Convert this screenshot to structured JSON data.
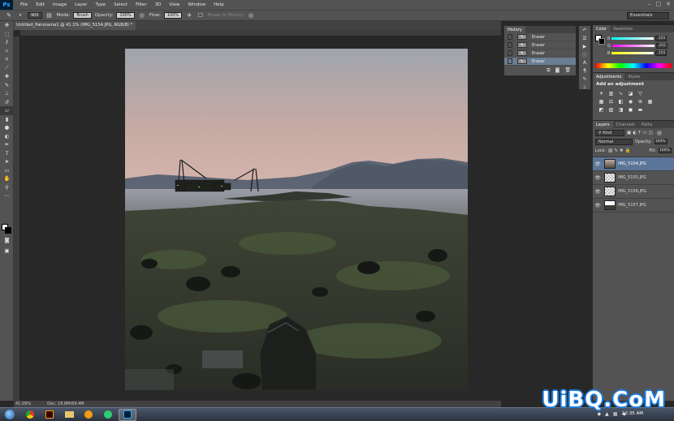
{
  "app": {
    "logo": "Ps"
  },
  "menu": [
    "File",
    "Edit",
    "Image",
    "Layer",
    "Type",
    "Select",
    "Filter",
    "3D",
    "View",
    "Window",
    "Help"
  ],
  "window_controls": [
    "–",
    "□",
    "✕"
  ],
  "options_bar": {
    "brush_size": "900",
    "mode_label": "Mode:",
    "mode_value": "Brush",
    "opacity_label": "Opacity:",
    "opacity_value": "100%",
    "flow_label": "Flow:",
    "flow_value": "100%",
    "erase_history": "Erase to History",
    "workspace": "Essentials"
  },
  "document": {
    "tab_title": "Untitled_Panorama1 @ 41.1% (IMG_5154.JPG, RGB/8) *",
    "zoom": "41.09%",
    "doc_info": "Doc: 16.8M/69.4M"
  },
  "history": {
    "tab": "History",
    "items": [
      {
        "label": "Eraser",
        "selected": false
      },
      {
        "label": "Eraser",
        "selected": false
      },
      {
        "label": "Eraser",
        "selected": false
      },
      {
        "label": "Eraser",
        "selected": true
      }
    ]
  },
  "color_panel": {
    "tabs": [
      "Color",
      "Swatches"
    ],
    "channels": [
      {
        "label": "R",
        "value": "255"
      },
      {
        "label": "G",
        "value": "255"
      },
      {
        "label": "B",
        "value": "255"
      }
    ]
  },
  "adjustments_panel": {
    "tabs": [
      "Adjustments",
      "Styles"
    ],
    "heading": "Add an adjustment"
  },
  "layers_panel": {
    "tabs": [
      "Layers",
      "Channels",
      "Paths"
    ],
    "kind": "Kind",
    "blend_mode": "Normal",
    "opacity_label": "Opacity:",
    "opacity_value": "100%",
    "lock_label": "Lock:",
    "fill_label": "Fill:",
    "fill_value": "100%",
    "layers": [
      {
        "name": "IMG_5154.JPG",
        "selected": true
      },
      {
        "name": "IMG_5155.JPG",
        "selected": false
      },
      {
        "name": "IMG_5156.JPG",
        "selected": false
      },
      {
        "name": "IMG_5157.JPG",
        "selected": false
      }
    ]
  },
  "taskbar": {
    "clock": "12:35 AM"
  },
  "watermark": "UiBQ.CoM",
  "colors": {
    "accent": "#5b7598",
    "panel": "#535353",
    "canvas_bg": "#282828"
  }
}
